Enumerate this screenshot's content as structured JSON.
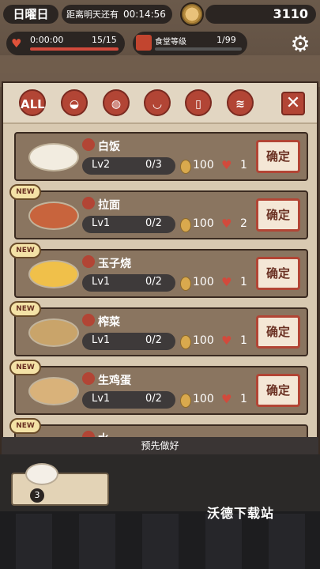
{
  "header": {
    "day": "日曜日",
    "countdown_label": "距离明天还有",
    "countdown_time": "00:14:56",
    "coins": "3110"
  },
  "stats": {
    "heart_time": "0:00:00",
    "heart_count": "15/15",
    "restaurant_label": "食堂等级",
    "restaurant_level": "1/99"
  },
  "tabs": [
    {
      "label": "ALL",
      "icon": "all-icon"
    },
    {
      "label": "",
      "icon": "rice-bowl-icon"
    },
    {
      "label": "",
      "icon": "plate-icon"
    },
    {
      "label": "",
      "icon": "soup-bowl-icon"
    },
    {
      "label": "",
      "icon": "drink-glass-icon"
    },
    {
      "label": "",
      "icon": "noodle-bowl-icon"
    }
  ],
  "items": [
    {
      "name": "白饭",
      "level": "Lv2",
      "count": "0/3",
      "price": "100",
      "love": "1",
      "confirm": "确定",
      "new": ""
    },
    {
      "name": "拉面",
      "level": "Lv1",
      "count": "0/2",
      "price": "100",
      "love": "2",
      "confirm": "确定",
      "new": "NEW"
    },
    {
      "name": "玉子烧",
      "level": "Lv1",
      "count": "0/2",
      "price": "100",
      "love": "1",
      "confirm": "确定",
      "new": "NEW"
    },
    {
      "name": "榨菜",
      "level": "Lv1",
      "count": "0/2",
      "price": "100",
      "love": "1",
      "confirm": "确定",
      "new": "NEW"
    },
    {
      "name": "生鸡蛋",
      "level": "Lv1",
      "count": "0/2",
      "price": "100",
      "love": "1",
      "confirm": "确定",
      "new": "NEW"
    },
    {
      "name": "水",
      "level": "",
      "count": "",
      "price": "",
      "love": "",
      "confirm": "",
      "new": "NEW"
    }
  ],
  "prepared": {
    "title": "预先做好",
    "count": "3"
  },
  "watermark": "沃德下载站"
}
